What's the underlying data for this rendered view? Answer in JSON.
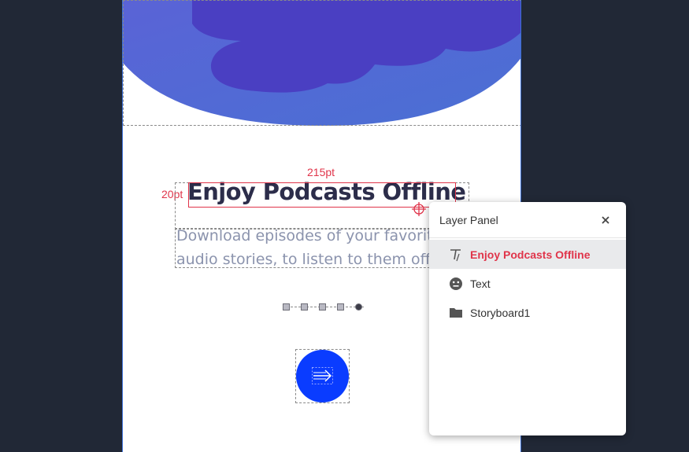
{
  "canvas": {
    "heading": "Enjoy Podcasts Offline",
    "body_line1": "Download episodes of your favorite",
    "body_line2": "audio stories, to listen to them offline",
    "width_label": "215pt",
    "height_label": "20pt",
    "pager": {
      "count": 5,
      "active_index": 4
    },
    "next_icon": "arrow-right-icon"
  },
  "layer_panel": {
    "title": "Layer Panel",
    "close_icon": "close-icon",
    "layers": [
      {
        "label": "Enjoy Podcasts Offline",
        "icon": "text-tool-icon",
        "selected": true
      },
      {
        "label": "Text",
        "icon": "face-icon",
        "selected": false
      },
      {
        "label": "Storyboard1",
        "icon": "folder-icon",
        "selected": false
      }
    ]
  },
  "colors": {
    "app_background": "#212836",
    "selection": "#e0344a",
    "hero_blob": "#4e50c9",
    "button": "#0a3cff",
    "heading_text": "#2c2d4a",
    "body_text": "#8b93ad"
  }
}
